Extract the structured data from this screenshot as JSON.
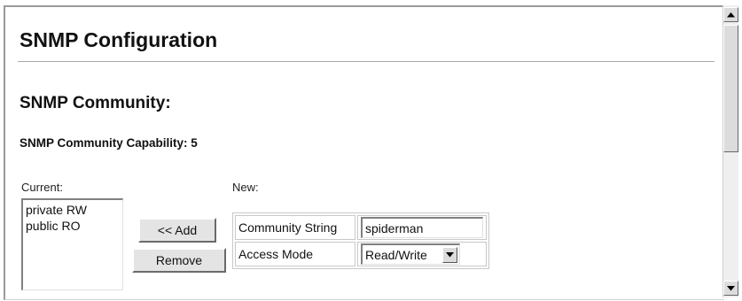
{
  "page": {
    "title": "SNMP Configuration",
    "section_heading": "SNMP Community:",
    "capability_label": "SNMP Community Capability: 5"
  },
  "current": {
    "label": "Current:",
    "items": [
      "private RW",
      "public RO"
    ]
  },
  "buttons": {
    "add_label": "<< Add",
    "remove_label": "Remove"
  },
  "new_entry": {
    "label": "New:",
    "community_string_label": "Community String",
    "community_string_value": "spiderman",
    "access_mode_label": "Access Mode",
    "access_mode_value": "Read/Write"
  },
  "icons": {
    "select_arrow": "triangle-down-icon",
    "scroll_up": "scroll-up-icon",
    "scroll_down": "scroll-down-icon"
  }
}
